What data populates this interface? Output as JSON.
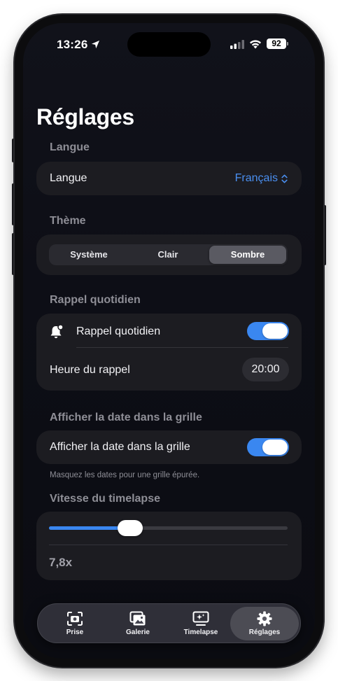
{
  "status_bar": {
    "time": "13:26",
    "battery": "92"
  },
  "title": "Réglages",
  "language": {
    "section_label": "Langue",
    "row_label": "Langue",
    "value": "Français"
  },
  "theme": {
    "section_label": "Thème",
    "options": [
      "Système",
      "Clair",
      "Sombre"
    ],
    "selected": "Sombre"
  },
  "reminder": {
    "section_label": "Rappel quotidien",
    "toggle_label": "Rappel quotidien",
    "toggle_on": true,
    "time_label": "Heure du rappel",
    "time_value": "20:00"
  },
  "grid_date": {
    "section_label": "Afficher la date dans la grille",
    "toggle_label": "Afficher la date dans la grille",
    "toggle_on": true,
    "footnote": "Masquez les dates pour une grille épurée."
  },
  "timelapse": {
    "section_label": "Vitesse du timelapse",
    "slider_fraction": 0.34,
    "value": "7,8x"
  },
  "tabbar": {
    "tabs": [
      {
        "label": "Prise",
        "icon": "camera-icon"
      },
      {
        "label": "Galerie",
        "icon": "gallery-icon"
      },
      {
        "label": "Timelapse",
        "icon": "timelapse-icon"
      },
      {
        "label": "Réglages",
        "icon": "gear-icon"
      }
    ],
    "active": "Réglages"
  },
  "colors": {
    "accent": "#3a87f0",
    "link": "#4a8ff0",
    "card": "#1c1c21"
  }
}
